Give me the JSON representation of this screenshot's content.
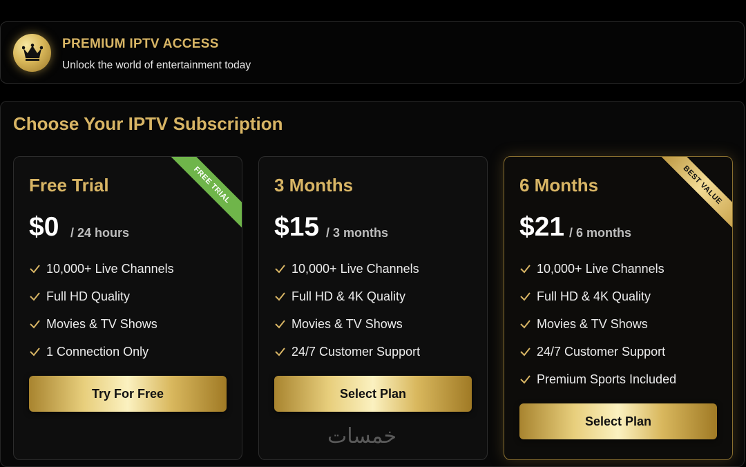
{
  "header": {
    "title": "PREMIUM IPTV ACCESS",
    "subtitle": "Unlock the world of entertainment today",
    "icon": "crown-icon"
  },
  "section": {
    "title": "Choose Your IPTV Subscription"
  },
  "plans": [
    {
      "title": "Free Trial",
      "price": "$0",
      "period": "/ 24 hours",
      "ribbon": "FREE TRIAL",
      "features": [
        "10,000+ Live Channels",
        "Full HD Quality",
        "Movies & TV Shows",
        "1 Connection Only"
      ],
      "button": "Try For Free"
    },
    {
      "title": "3 Months",
      "price": "$15",
      "period": "/ 3 months",
      "features": [
        "10,000+ Live Channels",
        "Full HD & 4K Quality",
        "Movies & TV Shows",
        "24/7 Customer Support"
      ],
      "button": "Select Plan"
    },
    {
      "title": "6 Months",
      "price": "$21",
      "period": "/ 6 months",
      "ribbon": "BEST VALUE",
      "features": [
        "10,000+ Live Channels",
        "Full HD & 4K Quality",
        "Movies & TV Shows",
        "24/7 Customer Support",
        "Premium Sports Included"
      ],
      "button": "Select Plan"
    }
  ],
  "watermark": "خمسات",
  "colors": {
    "gold": "#d8b565",
    "background": "#000000",
    "green_ribbon": "#6fb54a"
  }
}
